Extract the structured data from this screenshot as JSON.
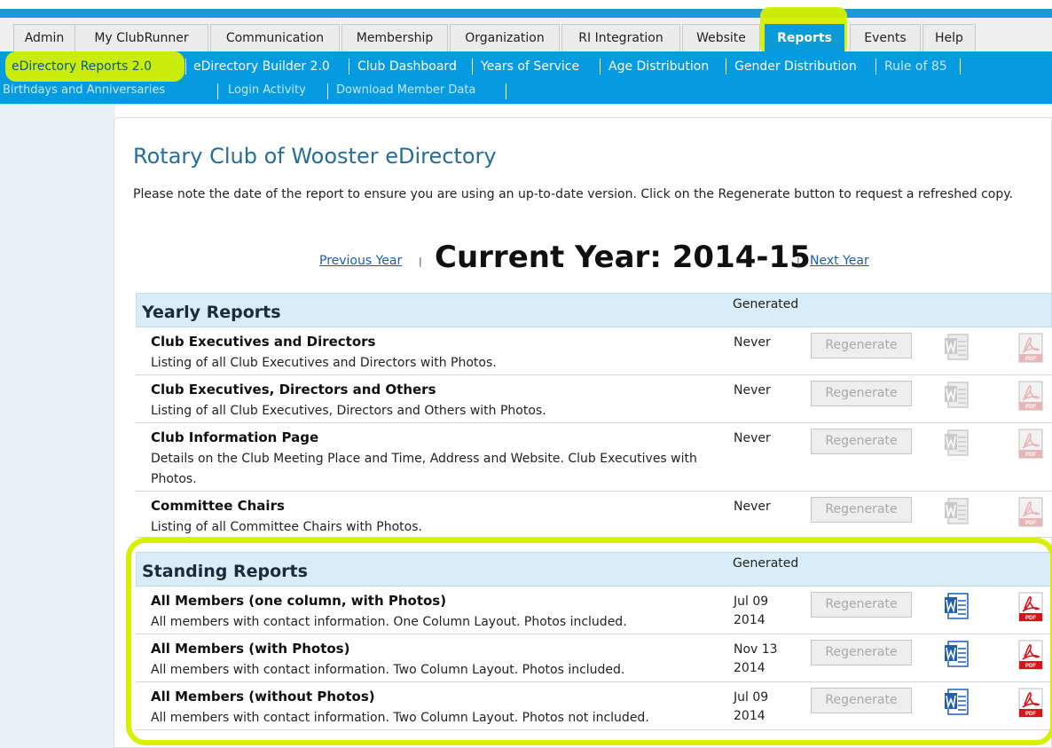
{
  "tabs": [
    {
      "label": "Admin"
    },
    {
      "label": "My ClubRunner"
    },
    {
      "label": "Communication"
    },
    {
      "label": "Membership"
    },
    {
      "label": "Organization"
    },
    {
      "label": "RI Integration"
    },
    {
      "label": "Website"
    },
    {
      "label": "Reports"
    },
    {
      "label": "Events"
    },
    {
      "label": "Help"
    }
  ],
  "subnav": [
    {
      "label": "eDirectory Reports 2.0"
    },
    {
      "label": "eDirectory Builder 2.0"
    },
    {
      "label": "Club Dashboard"
    },
    {
      "label": "Years of Service"
    },
    {
      "label": "Age Distribution"
    },
    {
      "label": "Gender Distribution"
    },
    {
      "label": "Rule of 85"
    },
    {
      "label": "Birthdays and Anniversaries"
    },
    {
      "label": "Login Activity"
    },
    {
      "label": "Download Member Data"
    }
  ],
  "page": {
    "title": "Rotary Club of Wooster eDirectory",
    "note": "Please note the date of the report to ensure you are using an up-to-date version. Click on the Regenerate button to request a refreshed copy.",
    "prev_year": "Previous Year",
    "current_year": "Current Year: 2014-15",
    "next_year": "Next Year",
    "pipe": "|"
  },
  "yearly": {
    "heading": "Yearly Reports",
    "generated": "Generated",
    "rows": [
      {
        "title": "Club Executives and Directors",
        "desc": "Listing of all Club Executives and Directors with Photos.",
        "date": "Never",
        "button": "Regenerate"
      },
      {
        "title": "Club Executives, Directors and Others",
        "desc": "Listing of all Club Executives, Directors and Others with Photos.",
        "date": "Never",
        "button": "Regenerate"
      },
      {
        "title": "Club Information Page",
        "desc": "Details on the Club Meeting Place and Time, Address and Website. Club Executives with Photos.",
        "date": "Never",
        "button": "Regenerate"
      },
      {
        "title": "Committee Chairs",
        "desc": "Listing of all Committee Chairs with Photos.",
        "date": "Never",
        "button": "Regenerate"
      }
    ]
  },
  "standing": {
    "heading": "Standing Reports",
    "generated": "Generated",
    "rows": [
      {
        "title": "All Members (one column, with Photos)",
        "desc": "All members with contact information. One Column Layout. Photos included.",
        "date": "Jul 09 2014",
        "button": "Regenerate"
      },
      {
        "title": "All Members (with Photos)",
        "desc": "All members with contact information. Two Column Layout. Photos included.",
        "date": "Nov 13 2014",
        "button": "Regenerate"
      },
      {
        "title": "All Members (without Photos)",
        "desc": "All members with contact information. Two Column Layout. Photos not included.",
        "date": "Jul 09 2014",
        "button": "Regenerate"
      }
    ]
  },
  "icons": {
    "word": "word-document-icon",
    "pdf": "pdf-document-icon"
  },
  "pdf_badge": "PDF",
  "colors": {
    "accent": "#049be0",
    "highlight": "#d4f000",
    "title": "#236e9b"
  }
}
